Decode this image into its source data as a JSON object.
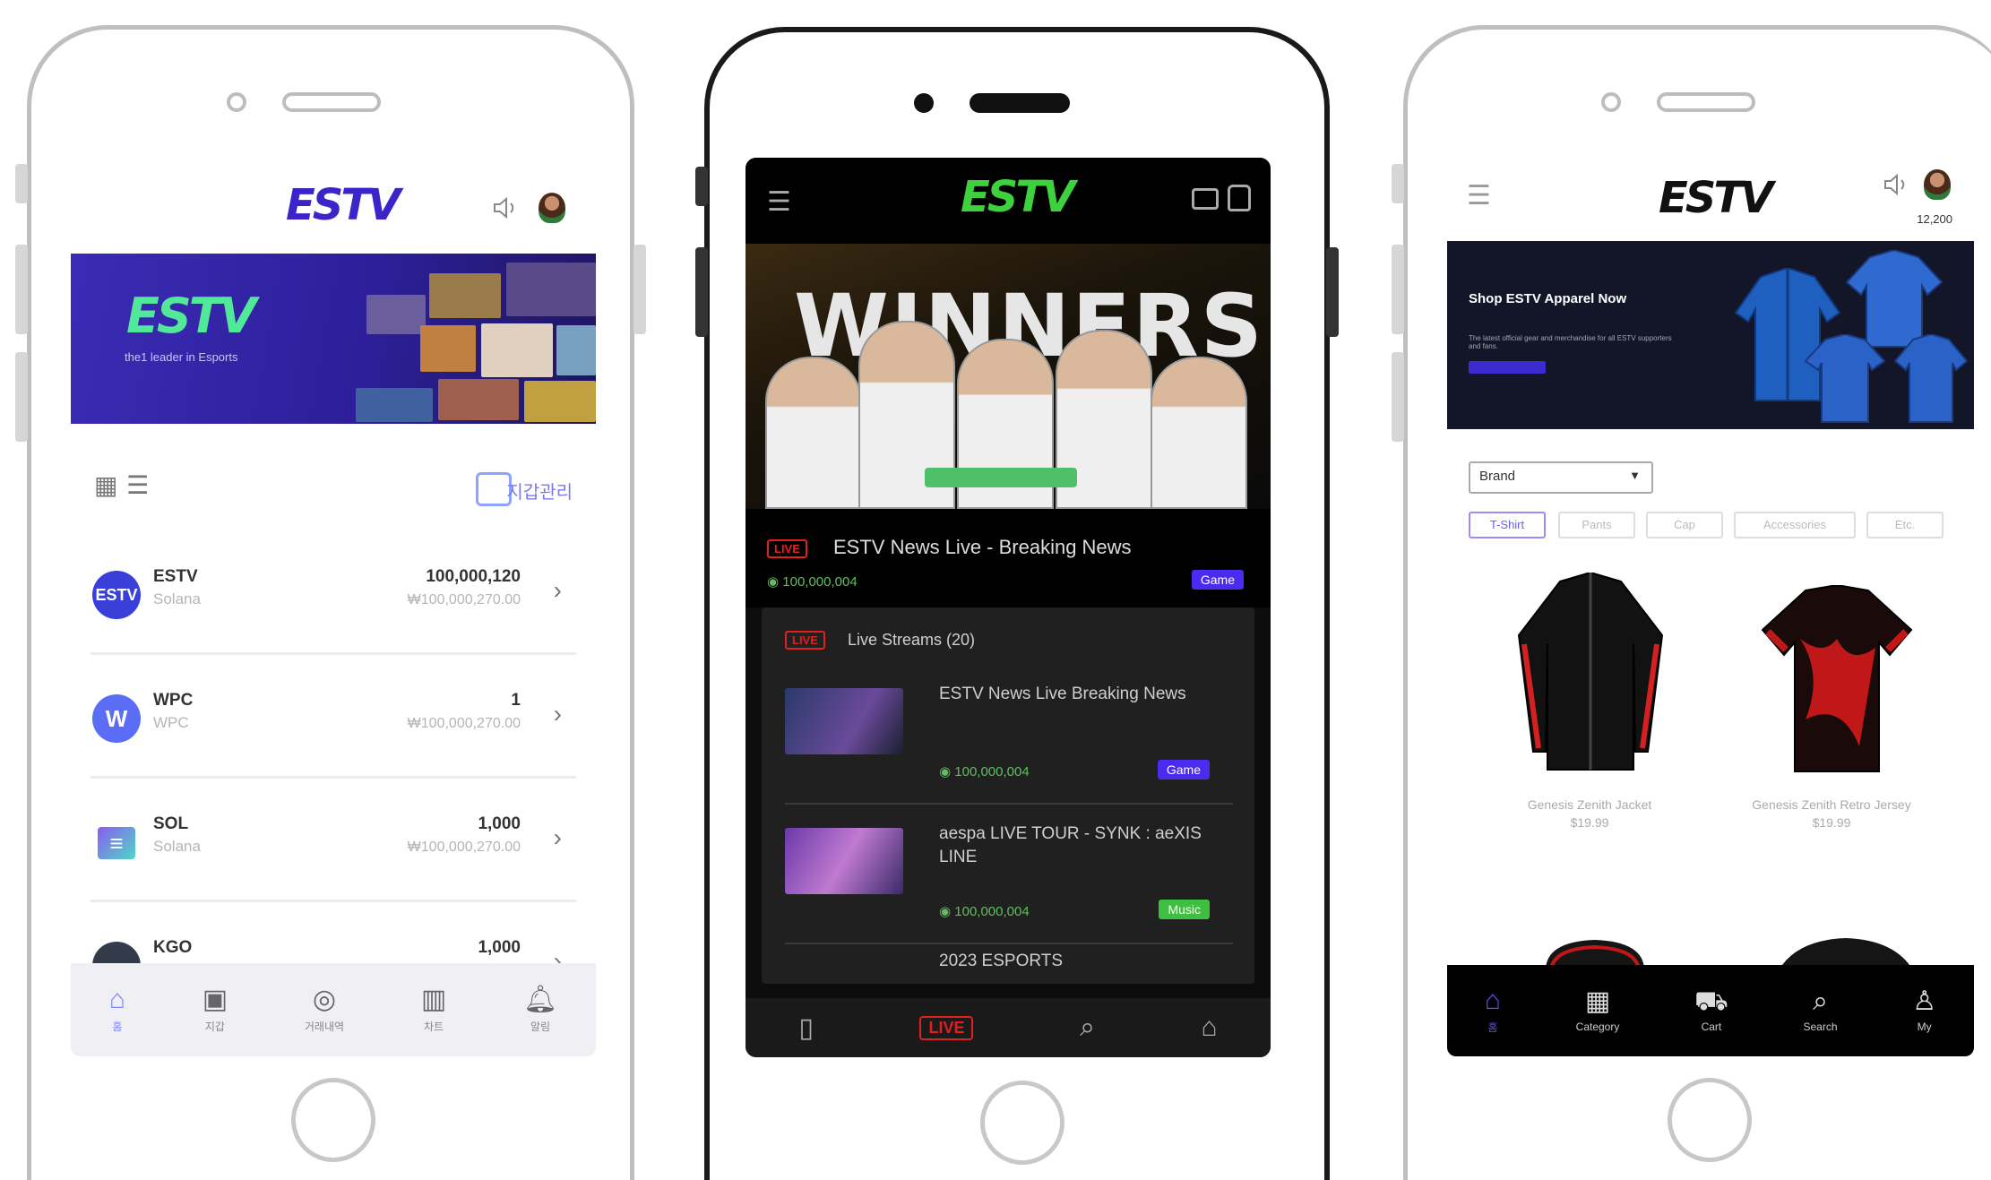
{
  "brand": {
    "logo_text": "ESTV"
  },
  "phone1": {
    "banner": {
      "logo_text": "ESTV",
      "sub_text": "the1 leader in Esports"
    },
    "toolbar": {
      "link_label": "지갑관리"
    },
    "assets": [
      {
        "symbol": "ESTV",
        "chain": "Solana",
        "amount": "100,000,120",
        "krw": "₩100,000,270.00",
        "coin_color": "#3b3fd9",
        "coin_label": "ESTV"
      },
      {
        "symbol": "WPC",
        "chain": "WPC",
        "amount": "1",
        "krw": "₩100,000,270.00",
        "coin_color": "#5b6cf5",
        "coin_label": "W"
      },
      {
        "symbol": "SOL",
        "chain": "Solana",
        "amount": "1,000",
        "krw": "₩100,000,270.00",
        "coin_color": "#6ad1d1",
        "coin_label": "≡"
      },
      {
        "symbol": "KGO",
        "chain": "",
        "amount": "1,000",
        "krw": "",
        "coin_color": "#333a4a",
        "coin_label": ""
      }
    ],
    "nav": [
      {
        "icon": "home-icon",
        "glyph": "⌂",
        "label": "홈",
        "active": true
      },
      {
        "icon": "wallet-icon",
        "glyph": "▣",
        "label": "지갑",
        "active": false
      },
      {
        "icon": "exchange-icon",
        "glyph": "◎",
        "label": "거래내역",
        "active": false
      },
      {
        "icon": "chart-icon",
        "glyph": "▥",
        "label": "차트",
        "active": false
      },
      {
        "icon": "bell-icon",
        "glyph": "♫",
        "label": "알림",
        "active": false
      }
    ]
  },
  "phone2": {
    "hero_title": "WINNERS",
    "live": {
      "badge": "LIVE",
      "title": "ESTV News Live - Breaking News",
      "viewers": "100,000,004",
      "tag": "Game"
    },
    "streams_header": {
      "badge": "LIVE",
      "label": "Live Streams (20)"
    },
    "streams": [
      {
        "title": "ESTV News Live Breaking News",
        "viewers": "100,000,004",
        "tag": "Game",
        "tag_color": "#4b2bf0"
      },
      {
        "title": "aespa LIVE TOUR - SYNK : aeXIS LINE",
        "viewers": "100,000,004",
        "tag": "Music",
        "tag_color": "#3fbf3f"
      },
      {
        "title": "2023 ESPORTS",
        "viewers": "",
        "tag": "",
        "tag_color": ""
      }
    ],
    "nav": {
      "live_label": "LIVE"
    }
  },
  "phone3": {
    "credits": "12,200",
    "banner": {
      "title": "Shop ESTV Apparel Now",
      "sub": "The latest official gear and merchandise for all ESTV supporters and fans."
    },
    "select_value": "Brand",
    "chips": [
      "T-Shirt",
      "Pants",
      "Cap",
      "Accessories",
      "Etc."
    ],
    "products": [
      {
        "name": "Genesis Zenith Jacket",
        "price": "$19.99"
      },
      {
        "name": "Genesis Zenith Retro Jersey",
        "price": "$19.99"
      }
    ],
    "nav": [
      {
        "icon": "home-icon",
        "glyph": "⌂",
        "label": "홈",
        "active": true
      },
      {
        "icon": "category-icon",
        "glyph": "▦",
        "label": "Category",
        "active": false
      },
      {
        "icon": "cart-icon",
        "glyph": "⛟",
        "label": "Cart",
        "active": false
      },
      {
        "icon": "search-icon",
        "glyph": "⌕",
        "label": "Search",
        "active": false
      },
      {
        "icon": "profile-icon",
        "glyph": "♙",
        "label": "My",
        "active": false
      }
    ]
  }
}
